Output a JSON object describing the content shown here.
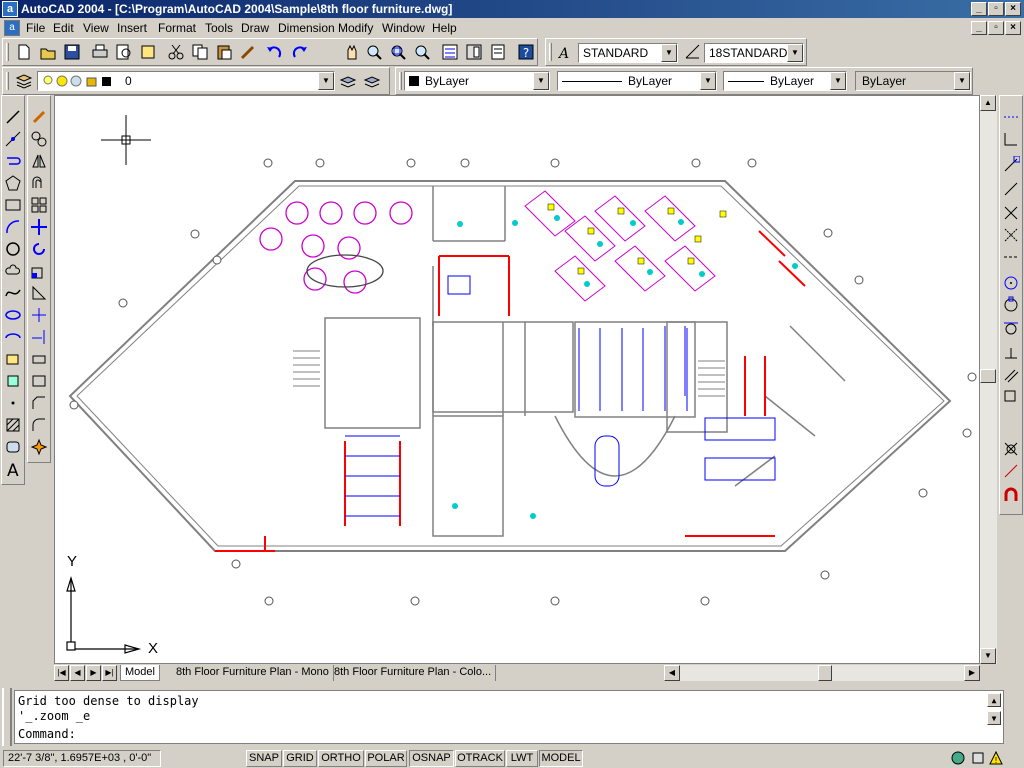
{
  "window": {
    "title": "AutoCAD 2004 - [C:\\Program\\AutoCAD 2004\\Sample\\8th floor furniture.dwg]",
    "app_icon_letter": "a"
  },
  "menu": [
    "File",
    "Edit",
    "View",
    "Insert",
    "Format",
    "Tools",
    "Draw",
    "Dimension",
    "Modify",
    "Window",
    "Help"
  ],
  "styles_toolbar": {
    "text_style": "STANDARD",
    "dim_style": "18STANDARD"
  },
  "layers_toolbar": {
    "current_layer": "0"
  },
  "properties_toolbar": {
    "color": "ByLayer",
    "linetype": "ByLayer",
    "lineweight": "ByLayer",
    "plotstyle": "ByLayer"
  },
  "ucs": {
    "x_label": "X",
    "y_label": "Y"
  },
  "layout_tabs": [
    "Model",
    "8th Floor Furniture Plan - Mono",
    "8th Floor Furniture Plan - Colo..."
  ],
  "command_window": {
    "line1": "Grid too dense to display",
    "line2": "'_.zoom _e",
    "prompt": "Command:"
  },
  "status": {
    "coordinates": "22'-7 3/8\",  1.6957E+03 , 0'-0\"",
    "buttons": [
      "SNAP",
      "GRID",
      "ORTHO",
      "POLAR",
      "OSNAP",
      "OTRACK",
      "LWT",
      "MODEL"
    ],
    "active_buttons": [
      "OSNAP",
      "MODEL"
    ]
  },
  "colors": {
    "title_start": "#0a246a",
    "title_end": "#3a6ea5",
    "chrome": "#d4d0c8",
    "furniture_blue": "#0000ff",
    "furniture_red": "#ff0000",
    "furniture_magenta": "#cc00cc",
    "furniture_yellow": "#ffff00",
    "furniture_cyan": "#00cccc",
    "walls": "#808080"
  }
}
